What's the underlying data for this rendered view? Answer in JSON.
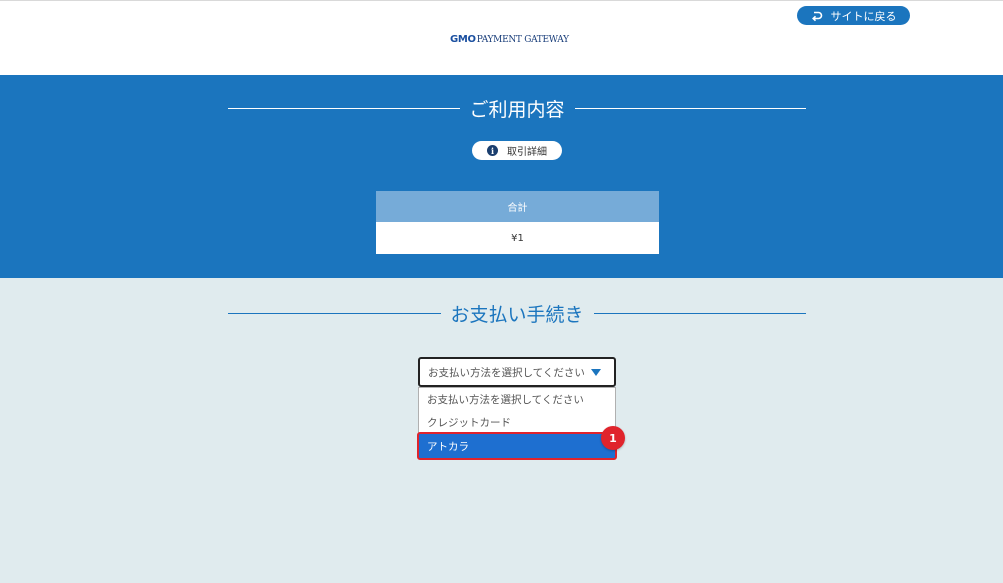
{
  "header": {
    "logo_bold": "GMO",
    "logo_rest": "PAYMENT GATEWAY",
    "back_button_label": "サイトに戻る"
  },
  "usage": {
    "title": "ご利用内容",
    "detail_button_label": "取引詳細",
    "total_label": "合計",
    "total_value": "¥1"
  },
  "payment": {
    "title": "お支払い手続き",
    "select_value": "お支払い方法を選択してください",
    "options": [
      "お支払い方法を選択してください",
      "クレジットカード",
      "アトカラ"
    ],
    "highlighted_option_index": 2,
    "step_badge": "1"
  },
  "colors": {
    "brand_blue": "#1b75be",
    "background": "#e0ebee",
    "highlight_blue": "#1e6fd0",
    "annotation_red": "#e0242c",
    "total_header": "#76abd8"
  },
  "icons": {
    "back": "return-arrow-icon",
    "info": "info-icon",
    "dropdown": "triangle-down-icon"
  }
}
